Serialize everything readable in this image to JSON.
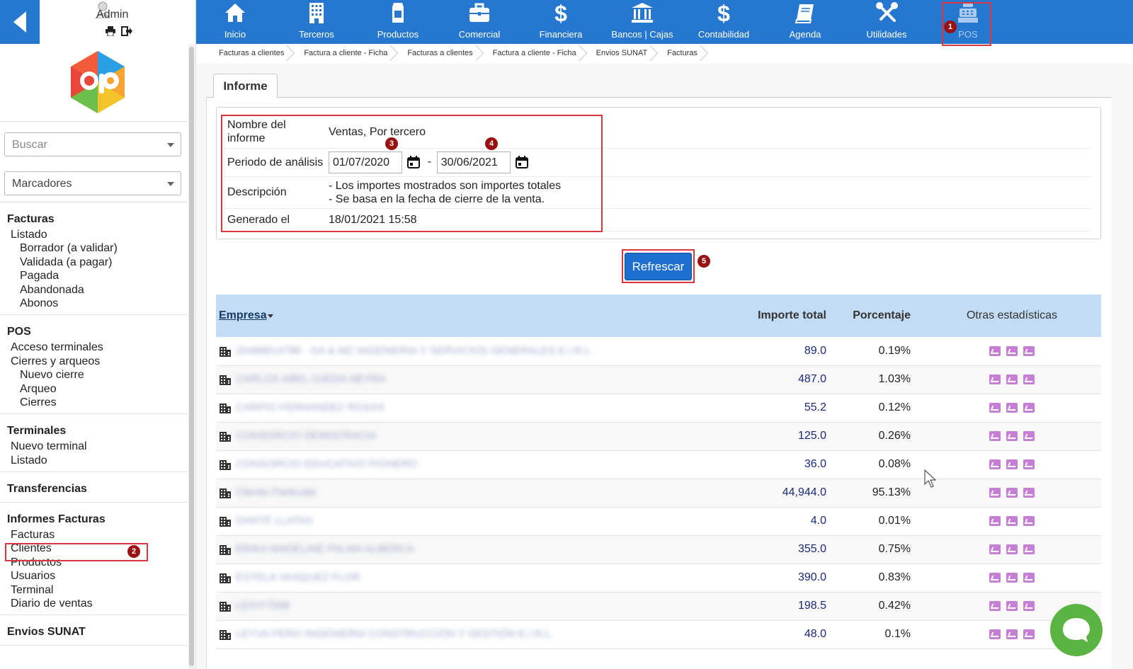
{
  "user": {
    "name": "Admin"
  },
  "sidebar": {
    "search_placeholder": "Buscar",
    "bookmarks_placeholder": "Marcadores",
    "sections": [
      {
        "title": "Facturas",
        "items": [
          {
            "label": "Listado",
            "level": 1
          },
          {
            "label": "Borrador (a validar)",
            "level": 2
          },
          {
            "label": "Validada (a pagar)",
            "level": 2
          },
          {
            "label": "Pagada",
            "level": 2
          },
          {
            "label": "Abandonada",
            "level": 2
          },
          {
            "label": "Abonos",
            "level": 2
          }
        ]
      },
      {
        "title": "POS",
        "items": [
          {
            "label": "Acceso terminales",
            "level": 1
          },
          {
            "label": "Cierres y arqueos",
            "level": 1
          },
          {
            "label": "Nuevo cierre",
            "level": 2
          },
          {
            "label": "Arqueo",
            "level": 2
          },
          {
            "label": "Cierres",
            "level": 2
          }
        ]
      },
      {
        "title": "Terminales",
        "items": [
          {
            "label": "Nuevo terminal",
            "level": 1
          },
          {
            "label": "Listado",
            "level": 1
          }
        ]
      },
      {
        "title": "Transferencias",
        "items": []
      },
      {
        "title": "Informes Facturas",
        "items": [
          {
            "label": "Facturas",
            "level": 1
          },
          {
            "label": "Clientes",
            "level": 1
          },
          {
            "label": "Productos",
            "level": 1
          },
          {
            "label": "Usuarios",
            "level": 1
          },
          {
            "label": "Terminal",
            "level": 1
          },
          {
            "label": "Diario de ventas",
            "level": 1
          }
        ]
      },
      {
        "title": "Envios SUNAT",
        "items": []
      }
    ]
  },
  "topnav": {
    "items": [
      {
        "label": "Inicio",
        "icon": "home-icon"
      },
      {
        "label": "Terceros",
        "icon": "building-icon"
      },
      {
        "label": "Productos",
        "icon": "box-icon"
      },
      {
        "label": "Comercial",
        "icon": "briefcase-icon"
      },
      {
        "label": "Financiera",
        "icon": "dollar-icon"
      },
      {
        "label": "Bancos | Cajas",
        "icon": "bank-icon"
      },
      {
        "label": "Contabilidad",
        "icon": "dollar-icon"
      },
      {
        "label": "Agenda",
        "icon": "book-icon"
      },
      {
        "label": "Utilidades",
        "icon": "tools-icon"
      },
      {
        "label": "POS",
        "icon": "cash-register-icon",
        "active": true
      }
    ]
  },
  "breadcrumb": [
    "Facturas a clientes",
    "Factura a cliente - Ficha",
    "Facturas a clientes",
    "Factura a cliente - Ficha",
    "Envios SUNAT",
    "Facturas"
  ],
  "tab": {
    "label": "Informe"
  },
  "report": {
    "name_label": "Nombre del informe",
    "name_value": "Ventas, Por tercero",
    "period_label": "Periodo de análisis",
    "date_from": "01/07/2020",
    "date_separator": "-",
    "date_to": "30/06/2021",
    "description_label": "Descripción",
    "description_line1": "- Los importes mostrados son importes totales",
    "description_line2": "- Se basa en la fecha de cierre de la venta.",
    "generated_label": "Generado el",
    "generated_value": "18/01/2021 15:58"
  },
  "refresh_button": {
    "label": "Refrescar"
  },
  "table": {
    "headers": {
      "company": "Empresa",
      "amount": "Importe total",
      "percent": "Porcentaje",
      "other": "Otras estadísticas"
    },
    "rows": [
      {
        "company": "20488914788 - GA & MZ INGENIERIA Y SERVICIOS GENERALES E.I.R.L.",
        "amount": "89.0",
        "percent": "0.19%"
      },
      {
        "company": "CARLOS ABEL OJEDA NEYRA",
        "amount": "487.0",
        "percent": "1.03%"
      },
      {
        "company": "CARPIO FERNANDEZ ROSAS",
        "amount": "55.2",
        "percent": "0.12%"
      },
      {
        "company": "CONSORCIO DEMOCRACIA",
        "amount": "125.0",
        "percent": "0.26%"
      },
      {
        "company": "CONSORCIO EDUCATIVO PIONERO",
        "amount": "36.0",
        "percent": "0.08%"
      },
      {
        "company": "Cliente Particular",
        "amount": "44,944.0",
        "percent": "95.13%"
      },
      {
        "company": "DANTE LLATAS",
        "amount": "4.0",
        "percent": "0.01%"
      },
      {
        "company": "ERIKA MADELINE PALMA ALBERCA",
        "amount": "355.0",
        "percent": "0.75%"
      },
      {
        "company": "ESTELA VASQUEZ FLOR",
        "amount": "390.0",
        "percent": "0.83%"
      },
      {
        "company": "LEIVY7568",
        "amount": "198.5",
        "percent": "0.42%"
      },
      {
        "company": "LEYVA PERO INGENIERIA CONSTRUCCIÓN Y GESTIÓN E.I.R.L.",
        "amount": "48.0",
        "percent": "0.1%"
      }
    ]
  },
  "annotations": [
    "1",
    "2",
    "3",
    "4",
    "5"
  ],
  "colors": {
    "nav_blue": "#2677cf",
    "header_blue": "#c3dcf5",
    "highlight_red": "#d9363e",
    "badge_red": "#9a1111"
  }
}
